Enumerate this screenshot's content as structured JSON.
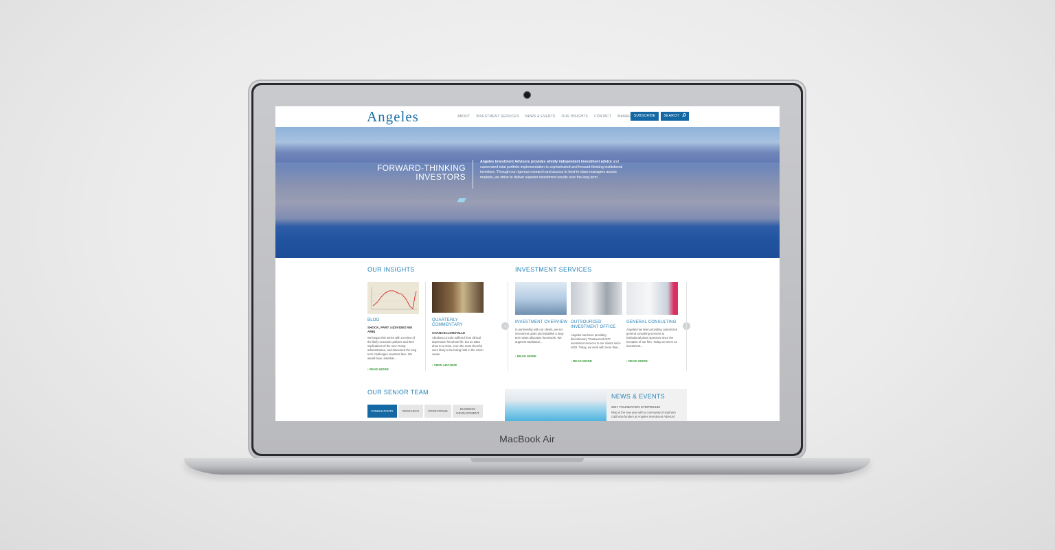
{
  "device": {
    "label": "MacBook Air"
  },
  "site": {
    "logo": "Angeles",
    "nav": [
      "ABOUT",
      "INVESTMENT SERVICES",
      "NEWS & EVENTS",
      "OUR INSIGHTS",
      "CONTACT",
      "MANAGERS"
    ],
    "subscribe_label": "SUBSCRIBE",
    "search_label": "SEARCH"
  },
  "hero": {
    "title_line1": "FORWARD-THINKING",
    "title_line2": "INVESTORS",
    "text_bold": "Angeles Investment Advisors provides wholly independent investment advice",
    "text_rest": " and customized total portfolio implementation to sophisticated and forward-thinking institutional investors. Through our rigorous research and access to best-in-class managers across markets, we strive to deliver superior investment results over the long term."
  },
  "insights": {
    "title": "OUR INSIGHTS",
    "cards": [
      {
        "category": "BLOG",
        "subtitle": "SHOCK, PART 4 (DIVIDED WE ARE)",
        "body": "We began this series with a review of the likely economic policies and their implications of the new Trump administration, and discussed the long term challenges investors face. We would have undertak...",
        "link": "READ MORE"
      },
      {
        "category": "QUARTERLY COMMENTARY",
        "subtitle": "CHANCELLORSVILLE",
        "body": "Abraham Lincoln suffered from clinical depression his whole life, but as 1862 drew to a close, even the most cheerful were likely to be losing faith in the Union cause.",
        "link": "VIEW ARCHIVE"
      }
    ]
  },
  "services": {
    "title": "INVESTMENT SERVICES",
    "cards": [
      {
        "category": "INVESTMENT OVERVIEW",
        "body": "In partnership with our clients, we set investment goals and establish a long-term asset allocation framework. We augment traditional...",
        "link": "READ MORE"
      },
      {
        "category": "OUTSOURCED INVESTMENT OFFICE",
        "body": "Angeles has been providing discretionary \"Outsourced CIO\" investment services to our clients since 2002. Today, we work with more than...",
        "link": "READ MORE"
      },
      {
        "category": "GENERAL CONSULTING",
        "body": "Angeles has been providing customized general consulting services to institutional plans sponsors since the inception of our firm. Today we serve as investment...",
        "link": "READ MORE"
      }
    ]
  },
  "team": {
    "title": "OUR SENIOR TEAM",
    "tabs": [
      "CONSULTANTS",
      "RESEARCH",
      "OPERATIONS",
      "BUSINESS DEVELOPMENT"
    ]
  },
  "news": {
    "title": "NEWS & EVENTS",
    "item_title": "2017 FOUNDATION SYMPOSIUM",
    "item_body": "Ring in the new year with a community of southern California funders at Angeles Investment Advisors'"
  },
  "colors": {
    "accent": "#1469a5",
    "link_green": "#3a9a3a",
    "heading_blue": "#1f7fb5"
  }
}
